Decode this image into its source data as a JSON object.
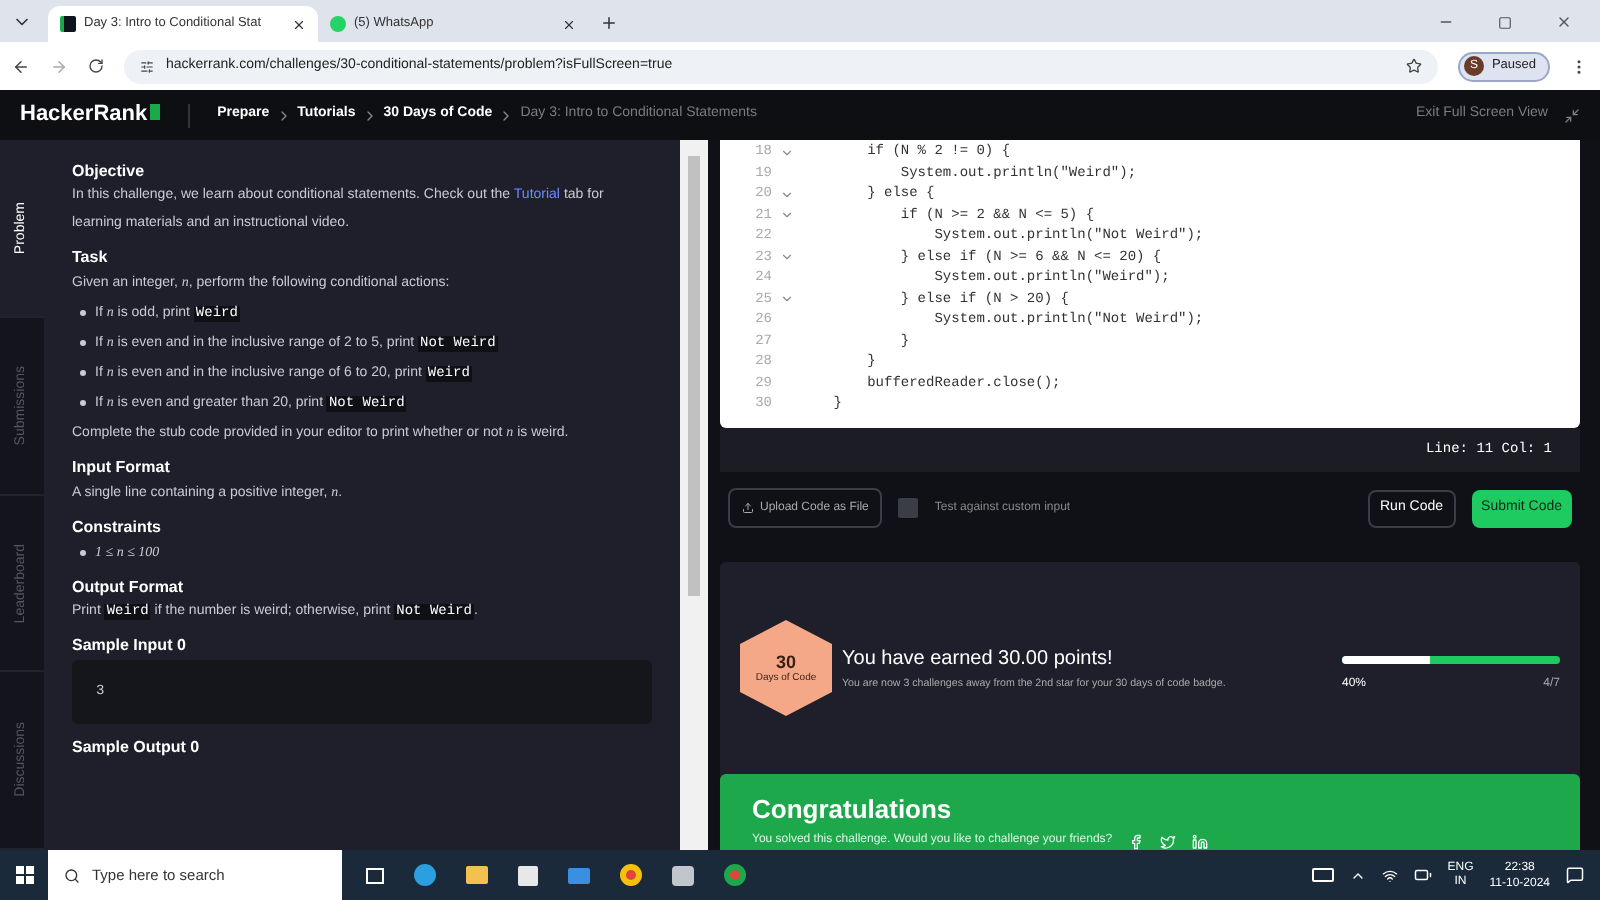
{
  "browser": {
    "tabs": [
      {
        "title": "Day 3: Intro to Conditional Stat",
        "selected": true,
        "kind": "hackerrank"
      },
      {
        "title": "(5) WhatsApp",
        "selected": false,
        "kind": "whatsapp"
      }
    ],
    "url": "hackerrank.com/challenges/30-conditional-statements/problem?isFullScreen=true",
    "profile_initial": "S",
    "profile_status": "Paused"
  },
  "nav": {
    "logo": "HackerRank",
    "breadcrumbs": [
      {
        "label": "Prepare",
        "current": false
      },
      {
        "label": "Tutorials",
        "current": false
      },
      {
        "label": "30 Days of Code",
        "current": false
      },
      {
        "label": "Day 3: Intro to Conditional Statements",
        "current": true
      }
    ],
    "exit": "Exit Full Screen View"
  },
  "side_tabs": [
    {
      "label": "Problem",
      "selected": true
    },
    {
      "label": "Submissions",
      "selected": false
    },
    {
      "label": "Leaderboard",
      "selected": false
    },
    {
      "label": "Discussions",
      "selected": false
    }
  ],
  "problem": [
    {
      "kind": "heading",
      "text": "Objective"
    },
    {
      "kind": "para",
      "parts": [
        {
          "kind": "text",
          "text": "In this challenge, we learn about conditional statements. Check out the "
        },
        {
          "kind": "link",
          "text": "Tutorial"
        },
        {
          "kind": "text",
          "text": " tab for learning materials and an instructional video."
        }
      ]
    },
    {
      "kind": "heading",
      "text": "Task"
    },
    {
      "kind": "para",
      "parts": [
        {
          "kind": "text",
          "text": "Given an integer, "
        },
        {
          "kind": "math",
          "text": "n"
        },
        {
          "kind": "text",
          "text": ", perform the following conditional actions:"
        }
      ]
    },
    {
      "kind": "bullet",
      "parts": [
        {
          "kind": "text",
          "text": "If "
        },
        {
          "kind": "math",
          "text": "n"
        },
        {
          "kind": "text",
          "text": " is odd, print "
        },
        {
          "kind": "code",
          "text": "Weird"
        }
      ]
    },
    {
      "kind": "bullet",
      "parts": [
        {
          "kind": "text",
          "text": "If "
        },
        {
          "kind": "math",
          "text": "n"
        },
        {
          "kind": "text",
          "text": " is even and in the inclusive range of 2 to 5, print "
        },
        {
          "kind": "code",
          "text": "Not Weird"
        }
      ]
    },
    {
      "kind": "bullet",
      "parts": [
        {
          "kind": "text",
          "text": "If "
        },
        {
          "kind": "math",
          "text": "n"
        },
        {
          "kind": "text",
          "text": " is even and in the inclusive range of 6 to 20, print "
        },
        {
          "kind": "code",
          "text": "Weird"
        }
      ]
    },
    {
      "kind": "bullet",
      "parts": [
        {
          "kind": "text",
          "text": "If "
        },
        {
          "kind": "math",
          "text": "n"
        },
        {
          "kind": "text",
          "text": " is even and greater than 20, print "
        },
        {
          "kind": "code",
          "text": "Not Weird"
        }
      ]
    },
    {
      "kind": "para",
      "parts": [
        {
          "kind": "text",
          "text": "Complete the stub code provided in your editor to print whether or not "
        },
        {
          "kind": "math",
          "text": "n"
        },
        {
          "kind": "text",
          "text": " is weird."
        }
      ]
    },
    {
      "kind": "heading",
      "text": "Input Format"
    },
    {
      "kind": "para",
      "parts": [
        {
          "kind": "text",
          "text": "A single line containing a positive integer, "
        },
        {
          "kind": "math",
          "text": "n"
        },
        {
          "kind": "text",
          "text": "."
        }
      ]
    },
    {
      "kind": "heading",
      "text": "Constraints"
    },
    {
      "kind": "bullet",
      "parts": [
        {
          "kind": "math",
          "text": "1 ≤ n ≤ 100"
        }
      ]
    },
    {
      "kind": "heading",
      "text": "Output Format"
    },
    {
      "kind": "para",
      "parts": [
        {
          "kind": "text",
          "text": "Print "
        },
        {
          "kind": "code",
          "text": "Weird"
        },
        {
          "kind": "text",
          "text": " if the number is weird; otherwise, print "
        },
        {
          "kind": "code",
          "text": "Not Weird"
        },
        {
          "kind": "text",
          "text": "."
        }
      ]
    },
    {
      "kind": "heading",
      "text": "Sample Input 0"
    },
    {
      "kind": "sample",
      "text": "3"
    },
    {
      "kind": "heading",
      "text": "Sample Output 0"
    }
  ],
  "editor": {
    "lines": [
      {
        "num": "18",
        "fold": true,
        "text": "        if (N % 2 != 0) {"
      },
      {
        "num": "19",
        "fold": false,
        "text": "            System.out.println(\"Weird\");"
      },
      {
        "num": "20",
        "fold": true,
        "text": "        } else {"
      },
      {
        "num": "21",
        "fold": true,
        "text": "            if (N >= 2 && N <= 5) {"
      },
      {
        "num": "22",
        "fold": false,
        "text": "                System.out.println(\"Not Weird\");"
      },
      {
        "num": "23",
        "fold": true,
        "text": "            } else if (N >= 6 && N <= 20) {"
      },
      {
        "num": "24",
        "fold": false,
        "text": "                System.out.println(\"Weird\");"
      },
      {
        "num": "25",
        "fold": true,
        "text": "            } else if (N > 20) {"
      },
      {
        "num": "26",
        "fold": false,
        "text": "                System.out.println(\"Not Weird\");"
      },
      {
        "num": "27",
        "fold": false,
        "text": "            }"
      },
      {
        "num": "28",
        "fold": false,
        "text": "        }"
      },
      {
        "num": "29",
        "fold": false,
        "text": "        bufferedReader.close();"
      },
      {
        "num": "30",
        "fold": false,
        "text": "    }"
      }
    ],
    "status": "Line: 11 Col: 1"
  },
  "actions": {
    "upload": "Upload Code as File",
    "custom_input": {
      "label": "Test against custom input",
      "checked": false
    },
    "run": "Run Code",
    "submit": "Submit Code"
  },
  "result": {
    "badge_number": "30",
    "badge_label": "Days of Code",
    "title": "You have earned 30.00 points!",
    "subtitle": "You are now 3 challenges away from the 2nd star for your 30 days of code badge.",
    "progress": {
      "level": 0.4,
      "percent": "40%",
      "count": "4/7"
    },
    "congrats_title": "Congratulations",
    "congrats_text": "You solved this challenge. Would you like to challenge your friends?"
  },
  "taskbar": {
    "search_placeholder": "Type here to search",
    "lang_top": "ENG",
    "lang_bottom": "IN",
    "time": "22:38",
    "date": "11-10-2024"
  }
}
